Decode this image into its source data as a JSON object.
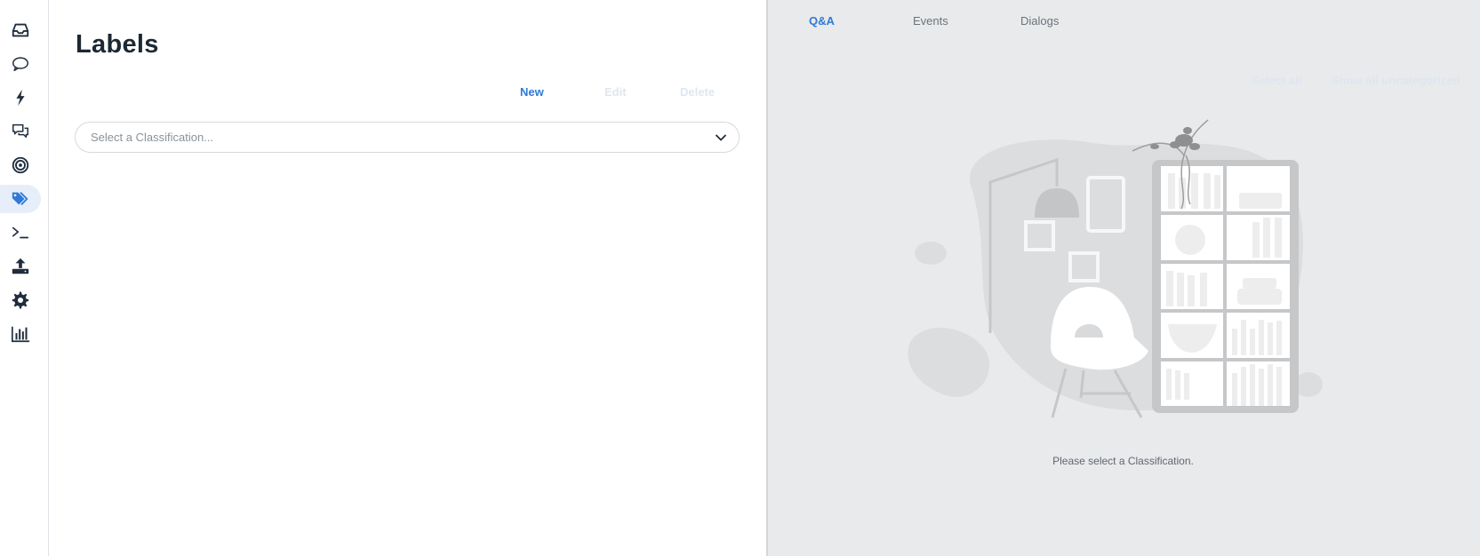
{
  "sidebar": {
    "items": [
      {
        "icon": "inbox-icon",
        "active": false
      },
      {
        "icon": "speech-bubble-icon",
        "active": false
      },
      {
        "icon": "lightning-icon",
        "active": false
      },
      {
        "icon": "conversations-icon",
        "active": false
      },
      {
        "icon": "target-icon",
        "active": false
      },
      {
        "icon": "tags-icon",
        "active": true
      },
      {
        "icon": "terminal-icon",
        "active": false
      },
      {
        "icon": "upload-icon",
        "active": false
      },
      {
        "icon": "gear-icon",
        "active": false
      },
      {
        "icon": "bar-chart-icon",
        "active": false
      }
    ],
    "active_color": "#2f7ad6"
  },
  "main": {
    "title": "Labels",
    "actions": {
      "new": "New",
      "edit": "Edit",
      "delete": "Delete"
    },
    "classification_select": {
      "placeholder": "Select a Classification...",
      "value": ""
    }
  },
  "right_panel": {
    "tabs": [
      {
        "label": "Q&A",
        "active": true
      },
      {
        "label": "Events",
        "active": false
      },
      {
        "label": "Dialogs",
        "active": false
      }
    ],
    "select_all": "Select all",
    "show_all_uncategorized": "Show all uncategorized",
    "empty_message": "Please select a Classification."
  },
  "colors": {
    "accent": "#2f7ad6",
    "panel_bg": "#e9eaec",
    "disabled": "#dfe6ee"
  }
}
